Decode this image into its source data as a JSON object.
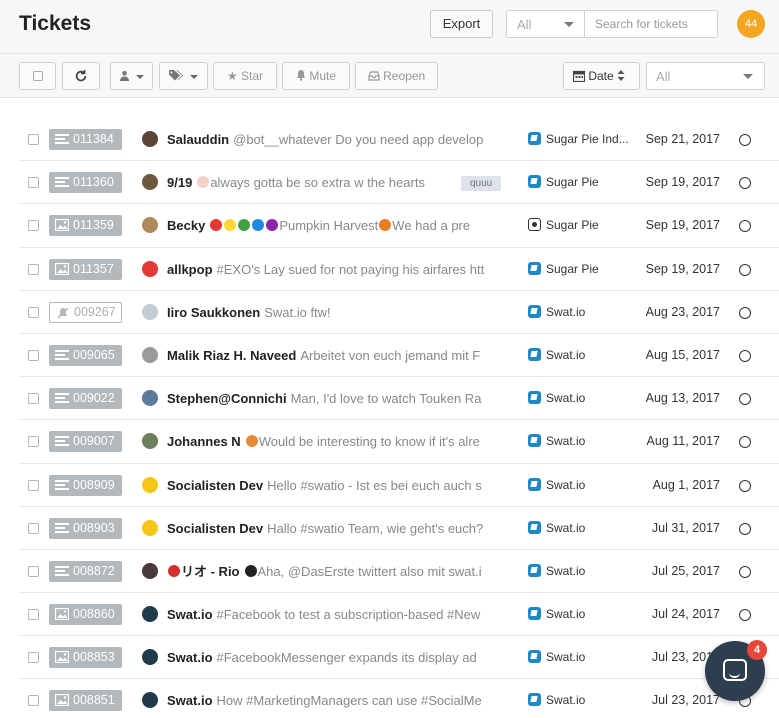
{
  "header": {
    "title": "Tickets",
    "export_label": "Export",
    "filter_value": "All",
    "search_placeholder": "Search for tickets",
    "avatar_count": "44"
  },
  "toolbar": {
    "star_label": "Star",
    "mute_label": "Mute",
    "reopen_label": "Reopen",
    "sort_label": "Date",
    "status_filter_value": "All"
  },
  "tickets": [
    {
      "id": "011384",
      "kind": "text",
      "user": "Salauddin",
      "snippet": "@bot__whatever Do you need app develop",
      "tag": "",
      "channel": "Sugar Pie Ind...",
      "channel_icon": "facebook-messenger-icon",
      "date": "Sep 21, 2017",
      "avatar_color": "#5a4636"
    },
    {
      "id": "011360",
      "kind": "text",
      "user": "9/19",
      "snippet": "always gotta be so extra w the hearts",
      "tag": "quuu",
      "channel": "Sugar Pie",
      "channel_icon": "facebook-messenger-icon",
      "date": "Sep 19, 2017",
      "avatar_color": "#6b5a3e",
      "emoji_after_user": [
        "#f5d0c5"
      ]
    },
    {
      "id": "011359",
      "kind": "image",
      "user": "Becky",
      "snippet": "Pumpkin Harvest",
      "snippet_after": "We had a pre",
      "tag": "",
      "channel": "Sugar Pie",
      "channel_icon": "instagram-icon",
      "date": "Sep 19, 2017",
      "avatar_color": "#b08a5a",
      "emoji_after_user": [
        "#e53935",
        "#fdd835",
        "#43a047",
        "#1e88e5",
        "#8e24aa"
      ]
    },
    {
      "id": "011357",
      "kind": "image",
      "user": "allkpop",
      "snippet": "#EXO's Lay sued for not paying his airfares htt",
      "tag": "",
      "channel": "Sugar Pie",
      "channel_icon": "facebook-messenger-icon",
      "date": "Sep 19, 2017",
      "avatar_color": "#e53935"
    },
    {
      "id": "009267",
      "kind": "muted",
      "user": "Iiro Saukkonen",
      "snippet": "Swat.io ftw!",
      "tag": "",
      "channel": "Swat.io",
      "channel_icon": "facebook-messenger-icon",
      "date": "Aug 23, 2017",
      "avatar_color": "#c5cbd3"
    },
    {
      "id": "009065",
      "kind": "text",
      "user": "Malik Riaz H. Naveed",
      "snippet": "Arbeitet von euch jemand mit F",
      "tag": "",
      "channel": "Swat.io",
      "channel_icon": "facebook-messenger-icon",
      "date": "Aug 15, 2017",
      "avatar_color": "#9a9a9a"
    },
    {
      "id": "009022",
      "kind": "text",
      "user": "Stephen@Connichi",
      "snippet": "Man, I'd love to watch Touken Ra",
      "tag": "",
      "channel": "Swat.io",
      "channel_icon": "facebook-messenger-icon",
      "date": "Aug 13, 2017",
      "avatar_color": "#5d7a9a"
    },
    {
      "id": "009007",
      "kind": "text",
      "user": "Johannes N",
      "snippet": "Would be interesting to know if it's alre",
      "tag": "",
      "channel": "Swat.io",
      "channel_icon": "facebook-messenger-icon",
      "date": "Aug 11, 2017",
      "avatar_color": "#6a7f5a",
      "emoji_after_user": [
        "#e58a3a"
      ]
    },
    {
      "id": "008909",
      "kind": "text",
      "user": "Socialisten Dev",
      "snippet": "Hello #swatio - Ist es bei euch auch s",
      "tag": "",
      "channel": "Swat.io",
      "channel_icon": "facebook-messenger-icon",
      "date": "Aug 1, 2017",
      "avatar_color": "#f5c518"
    },
    {
      "id": "008903",
      "kind": "text",
      "user": "Socialisten Dev",
      "snippet": "Hallo #swatio Team, wie geht's euch?",
      "tag": "",
      "channel": "Swat.io",
      "channel_icon": "facebook-messenger-icon",
      "date": "Jul 31, 2017",
      "avatar_color": "#f5c518"
    },
    {
      "id": "008872",
      "kind": "text",
      "user": "リオ - Rio",
      "snippet": "Aha, @DasErste twittert also mit swat.i",
      "tag": "",
      "channel": "Swat.io",
      "channel_icon": "facebook-messenger-icon",
      "date": "Jul 25, 2017",
      "avatar_color": "#4a3a3a",
      "emoji_before_user": [
        "#d32f2f"
      ],
      "emoji_after_user": [
        "#222222"
      ]
    },
    {
      "id": "008860",
      "kind": "image",
      "user": "Swat.io",
      "snippet": "#Facebook to test a subscription-based #New",
      "tag": "",
      "channel": "Swat.io",
      "channel_icon": "facebook-messenger-icon",
      "date": "Jul 24, 2017",
      "avatar_color": "#1f3a4a"
    },
    {
      "id": "008853",
      "kind": "image",
      "user": "Swat.io",
      "snippet": "#FacebookMessenger expands its display ad",
      "tag": "",
      "channel": "Swat.io",
      "channel_icon": "facebook-messenger-icon",
      "date": "Jul 23, 2017",
      "avatar_color": "#1f3a4a"
    },
    {
      "id": "008851",
      "kind": "image",
      "user": "Swat.io",
      "snippet": "How #MarketingManagers can use #SocialMe",
      "tag": "",
      "channel": "Swat.io",
      "channel_icon": "facebook-messenger-icon",
      "date": "Jul 23, 2017",
      "avatar_color": "#1f3a4a"
    }
  ],
  "chat": {
    "unread_count": "4"
  }
}
